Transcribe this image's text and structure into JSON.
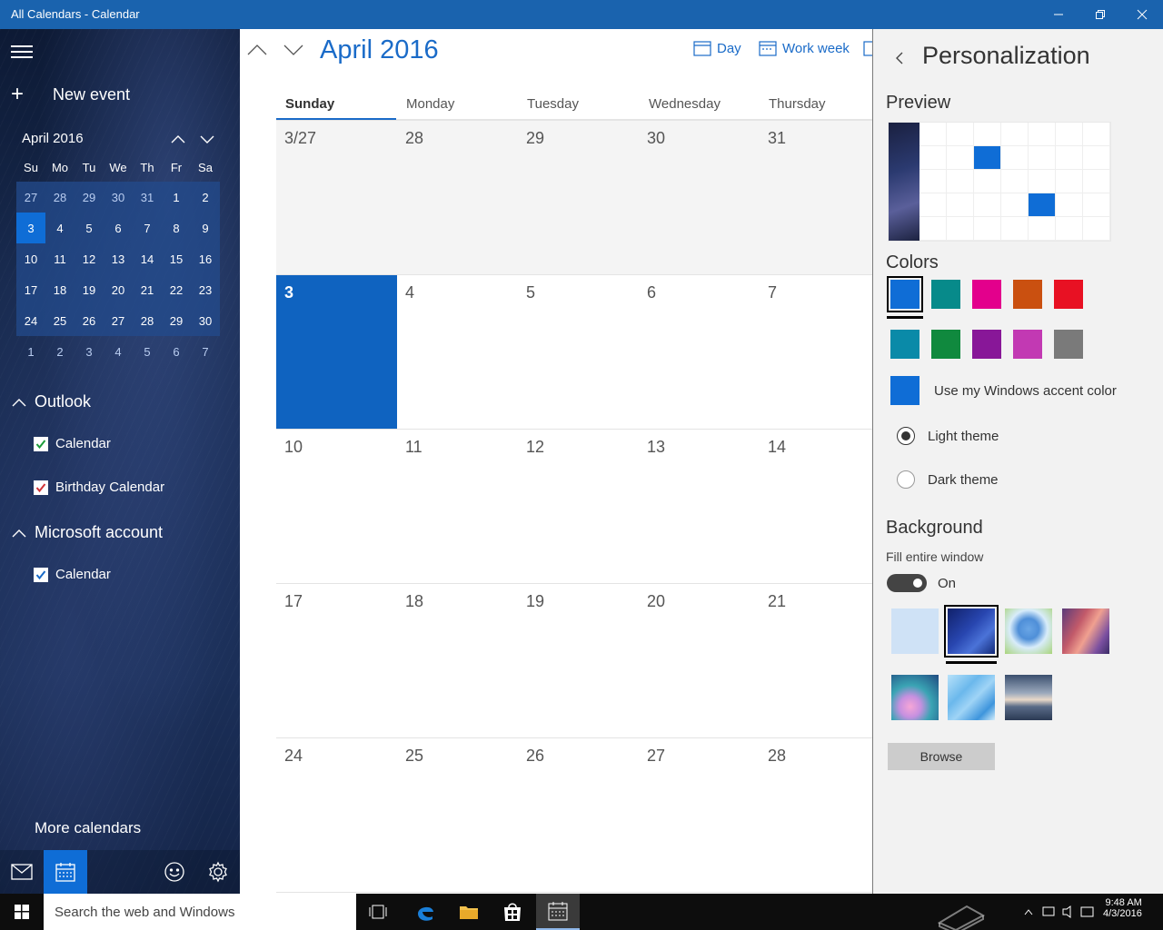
{
  "window": {
    "title": "All Calendars - Calendar"
  },
  "sidebar": {
    "new_event": "New event",
    "mini_calendar": {
      "title": "April 2016",
      "dow": [
        "Su",
        "Mo",
        "Tu",
        "We",
        "Th",
        "Fr",
        "Sa"
      ],
      "days": [
        "27",
        "28",
        "29",
        "30",
        "31",
        "1",
        "2",
        "3",
        "4",
        "5",
        "6",
        "7",
        "8",
        "9",
        "10",
        "11",
        "12",
        "13",
        "14",
        "15",
        "16",
        "17",
        "18",
        "19",
        "20",
        "21",
        "22",
        "23",
        "24",
        "25",
        "26",
        "27",
        "28",
        "29",
        "30",
        "1",
        "2",
        "3",
        "4",
        "5",
        "6",
        "7"
      ],
      "today": "3"
    },
    "groups": [
      {
        "label": "Outlook",
        "calendars": [
          {
            "label": "Calendar",
            "color": "#1e9c3c"
          },
          {
            "label": "Birthday Calendar",
            "color": "#d13438"
          }
        ]
      },
      {
        "label": "Microsoft account",
        "calendars": [
          {
            "label": "Calendar",
            "color": "#1a6bc8"
          }
        ]
      }
    ],
    "more_calendars": "More calendars"
  },
  "main": {
    "month_title": "April 2016",
    "views": [
      "Day",
      "Work week"
    ],
    "weekdays": [
      "Sunday",
      "Monday",
      "Tuesday",
      "Wednesday",
      "Thursday"
    ],
    "weeks": [
      [
        "3/27",
        "28",
        "29",
        "30",
        "31"
      ],
      [
        "3",
        "4",
        "5",
        "6",
        "7"
      ],
      [
        "10",
        "11",
        "12",
        "13",
        "14"
      ],
      [
        "17",
        "18",
        "19",
        "20",
        "21"
      ],
      [
        "24",
        "25",
        "26",
        "27",
        "28"
      ]
    ]
  },
  "panel": {
    "title": "Personalization",
    "preview_label": "Preview",
    "colors_label": "Colors",
    "colors_row1": [
      "#0f6dd6",
      "#078a8a",
      "#e3008c",
      "#ca5010",
      "#e81123"
    ],
    "colors_row2": [
      "#0a8aa8",
      "#10893e",
      "#881798",
      "#c239b3",
      "#7a7a7a"
    ],
    "accent_label": "Use my Windows accent color",
    "accent_color": "#0f6dd6",
    "light_theme": "Light theme",
    "dark_theme": "Dark theme",
    "selected_theme": "light",
    "background_label": "Background",
    "fill_label": "Fill entire window",
    "toggle_label": "On",
    "browse_label": "Browse"
  },
  "taskbar": {
    "search_placeholder": "Search the web and Windows",
    "time": "9:48 AM",
    "date": "4/3/2016"
  }
}
